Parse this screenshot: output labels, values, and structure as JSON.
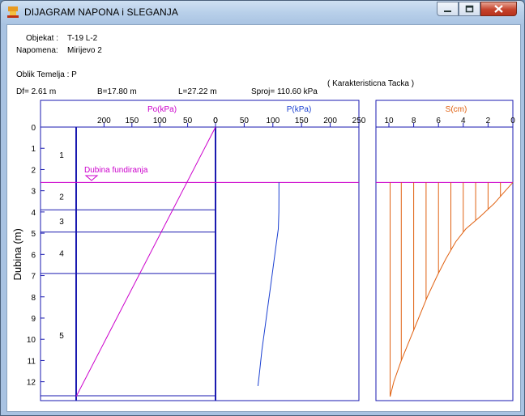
{
  "window": {
    "title": "DIJAGRAM NAPONA i SLEGANJA"
  },
  "header": {
    "objekat_label": "Objekat :",
    "objekat_value": "T-19  L-2",
    "napomena_label": "Napomena:",
    "napomena_value": "Mirijevo 2",
    "oblik_temelja": "Oblik Temelja : P",
    "df": "Df= 2.61 m",
    "b": "B=17.80 m",
    "l": "L=27.22 m",
    "sproj": "Sproj= 110.60 kPa",
    "tacka": "( Karakteristicna Tacka )"
  },
  "colors": {
    "po": "#cc00cc",
    "p": "#1a3fd1",
    "s": "#e06010",
    "axis": "#1a1ab0",
    "layer": "#1a1ab0"
  },
  "chart_data": [
    {
      "type": "line",
      "title": "",
      "ylabel": "Dubina (m)",
      "ylim": [
        0,
        12.7
      ],
      "y_ticks": [
        "0",
        "1",
        "2",
        "3",
        "4",
        "5",
        "6",
        "7",
        "8",
        "9",
        "10",
        "11",
        "12"
      ],
      "layers": [
        {
          "label": "1",
          "bottom": 2.61
        },
        {
          "label": "2",
          "bottom": 3.9
        },
        {
          "label": "3",
          "bottom": 4.95
        },
        {
          "label": "4",
          "bottom": 6.9
        },
        {
          "label": "5",
          "bottom": 12.7
        }
      ],
      "annotation": {
        "text": "Dubina fundiranja",
        "depth": 2.61
      },
      "series": [
        {
          "name": "Po(kPa)",
          "x_ticks": [
            "200",
            "150",
            "100",
            "50",
            "0"
          ],
          "xlim": [
            250,
            0
          ],
          "points": [
            [
              0,
              0
            ],
            [
              250,
              12.7
            ]
          ]
        },
        {
          "name": "P(kPa)",
          "x_ticks": [
            "50",
            "100",
            "150",
            "200",
            "250"
          ],
          "xlim": [
            0,
            250
          ],
          "points": [
            [
              110.6,
              2.61
            ],
            [
              110.6,
              3.2
            ],
            [
              110.5,
              4.0
            ],
            [
              109.5,
              4.8
            ],
            [
              106,
              5.5
            ],
            [
              101,
              6.5
            ],
            [
              96,
              7.5
            ],
            [
              91,
              8.5
            ],
            [
              86,
              9.5
            ],
            [
              81,
              10.5
            ],
            [
              77,
              11.5
            ],
            [
              74,
              12.2
            ]
          ]
        }
      ]
    },
    {
      "type": "line",
      "title": "",
      "series": [
        {
          "name": "S(cm)",
          "x_ticks": [
            "10",
            "8",
            "6",
            "4",
            "2",
            "0"
          ],
          "xlim": [
            11,
            0
          ],
          "points": [
            [
              0,
              2.61
            ],
            [
              0.6,
              3.0
            ],
            [
              1.5,
              3.6
            ],
            [
              2.6,
              4.2
            ],
            [
              3.8,
              4.8
            ],
            [
              4.6,
              5.4
            ],
            [
              5.4,
              6.2
            ],
            [
              6.1,
              7.0
            ],
            [
              6.9,
              8.0
            ],
            [
              7.6,
              9.0
            ],
            [
              8.3,
              10.0
            ],
            [
              9.0,
              11.0
            ],
            [
              9.6,
              12.0
            ],
            [
              9.9,
              12.7
            ]
          ]
        }
      ]
    }
  ]
}
